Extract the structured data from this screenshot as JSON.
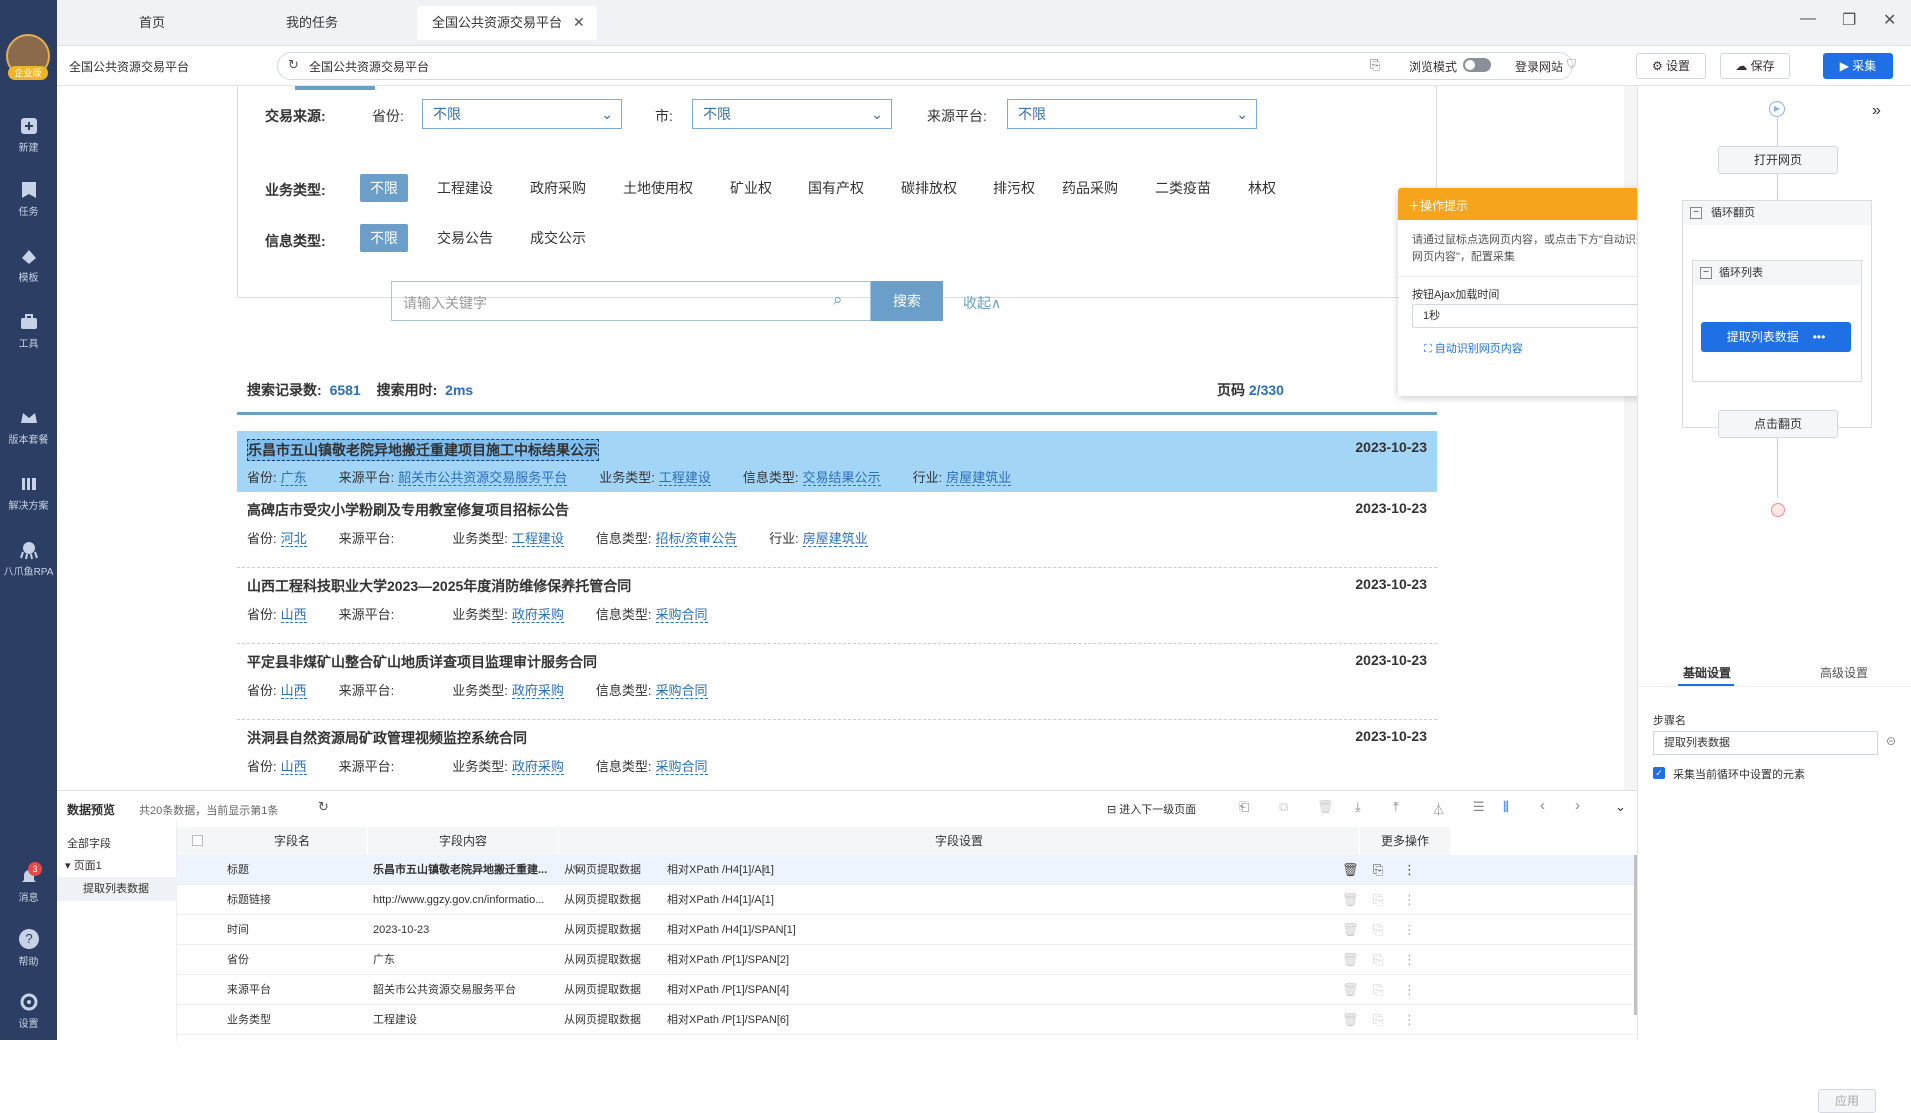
{
  "sidebar": {
    "avatar_label": "企业版",
    "items": [
      {
        "label": "新建",
        "icon": "plus-icon"
      },
      {
        "label": "任务",
        "icon": "bookmark-icon"
      },
      {
        "label": "模板",
        "icon": "template-icon"
      },
      {
        "label": "工具",
        "icon": "toolbox-icon"
      },
      {
        "label": "版本套餐",
        "icon": "crown-icon"
      },
      {
        "label": "解决方案",
        "icon": "solution-icon"
      },
      {
        "label": "八爪鱼RPA",
        "icon": "octopus-icon"
      }
    ],
    "bottom": [
      {
        "label": "消息",
        "badge": "3"
      },
      {
        "label": "帮助"
      },
      {
        "label": "设置"
      }
    ]
  },
  "tabs": [
    {
      "label": "首页"
    },
    {
      "label": "我的任务"
    },
    {
      "label": "全国公共资源交易平台"
    }
  ],
  "address": {
    "page_title": "全国公共资源交易平台",
    "url": "全国公共资源交易平台",
    "browse_mode": "浏览模式",
    "login_site": "登录网站"
  },
  "toolbar": {
    "settings": "设置",
    "save": "保存",
    "collect": "采集"
  },
  "filters": {
    "source_label": "交易来源:",
    "province_label": "省份:",
    "province_value": "不限",
    "city_label": "市:",
    "city_value": "不限",
    "platform_label": "来源平台:",
    "platform_value": "不限",
    "biz_label": "业务类型:",
    "biz_options": [
      "不限",
      "工程建设",
      "政府采购",
      "土地使用权",
      "矿业权",
      "国有产权",
      "碳排放权",
      "排污权",
      "药品采购",
      "二类疫苗",
      "林权"
    ],
    "info_label": "信息类型:",
    "info_options": [
      "不限",
      "交易公告",
      "成交公示"
    ],
    "search_placeholder": "请输入关键字",
    "search_btn": "搜索",
    "collapse": "收起∧"
  },
  "stats": {
    "records_label": "搜索记录数:",
    "records": "6581",
    "time_label": "搜索用时:",
    "time": "2ms",
    "page_label": "页码",
    "page": "2/330"
  },
  "results": [
    {
      "title": "乐昌市五山镇敬老院异地搬迁重建项目施工中标结果公示",
      "date": "2023-10-23",
      "meta": [
        [
          "省份:",
          "广东"
        ],
        [
          "来源平台:",
          "韶关市公共资源交易服务平台"
        ],
        [
          "业务类型:",
          "工程建设"
        ],
        [
          "信息类型:",
          "交易结果公示"
        ],
        [
          "行业:",
          "房屋建筑业"
        ]
      ]
    },
    {
      "title": "高碑店市受灾小学粉刷及专用教室修复项目招标公告",
      "date": "2023-10-23",
      "meta": [
        [
          "省份:",
          "河北"
        ],
        [
          "来源平台:",
          ""
        ],
        [
          "业务类型:",
          "工程建设"
        ],
        [
          "信息类型:",
          "招标/资审公告"
        ],
        [
          "行业:",
          "房屋建筑业"
        ]
      ]
    },
    {
      "title": "山西工程科技职业大学2023—2025年度消防维修保养托管合同",
      "date": "2023-10-23",
      "meta": [
        [
          "省份:",
          "山西"
        ],
        [
          "来源平台:",
          ""
        ],
        [
          "业务类型:",
          "政府采购"
        ],
        [
          "信息类型:",
          "采购合同"
        ]
      ]
    },
    {
      "title": "平定县非煤矿山整合矿山地质详查项目监理审计服务合同",
      "date": "2023-10-23",
      "meta": [
        [
          "省份:",
          "山西"
        ],
        [
          "来源平台:",
          ""
        ],
        [
          "业务类型:",
          "政府采购"
        ],
        [
          "信息类型:",
          "采购合同"
        ]
      ]
    },
    {
      "title": "洪洞县自然资源局矿政管理视频监控系统合同",
      "date": "2023-10-23",
      "meta": [
        [
          "省份:",
          "山西"
        ],
        [
          "来源平台:",
          ""
        ],
        [
          "业务类型:",
          "政府采购"
        ],
        [
          "信息类型:",
          "采购合同"
        ]
      ]
    }
  ],
  "tip": {
    "title": "操作提示",
    "body": "请通过鼠标点选网页内容，或点击下方\"自动识别网页内容\"，配置采集",
    "ajax_label": "按钮Ajax加载时间",
    "ajax_value": "1秒",
    "auto": "自动识别网页内容"
  },
  "flow": {
    "open": "打开网页",
    "loop_page": "循环翻页",
    "loop_list": "循环列表",
    "extract": "提取列表数据",
    "next": "点击翻页",
    "tab_basic": "基础设置",
    "tab_adv": "高级设置",
    "step_label": "步骤名",
    "step_value": "提取列表数据",
    "checkbox": "采集当前循环中设置的元素",
    "apply": "应用"
  },
  "preview": {
    "title": "数据预览",
    "summary": "共20条数据，当前显示第1条",
    "enter_next": "进入下一级页面",
    "all_fields": "全部字段",
    "page1": "页面1",
    "extract": "提取列表数据",
    "cols": [
      "字段名",
      "字段内容",
      "字段设置",
      "更多操作"
    ],
    "rows": [
      {
        "name": "标题",
        "content": "乐昌市五山镇敬老院异地搬迁重建...",
        "src": "从网页提取数据",
        "xp": "相对XPath",
        "path": "/H4[1]/A[1]"
      },
      {
        "name": "标题链接",
        "content": "http://www.ggzy.gov.cn/informatio...",
        "src": "从网页提取数据",
        "xp": "相对XPath",
        "path": "/H4[1]/A[1]"
      },
      {
        "name": "时间",
        "content": "2023-10-23",
        "src": "从网页提取数据",
        "xp": "相对XPath",
        "path": "/H4[1]/SPAN[1]"
      },
      {
        "name": "省份",
        "content": "广东",
        "src": "从网页提取数据",
        "xp": "相对XPath",
        "path": "/P[1]/SPAN[2]"
      },
      {
        "name": "来源平台",
        "content": "韶关市公共资源交易服务平台",
        "src": "从网页提取数据",
        "xp": "相对XPath",
        "path": "/P[1]/SPAN[4]"
      },
      {
        "name": "业务类型",
        "content": "工程建设",
        "src": "从网页提取数据",
        "xp": "相对XPath",
        "path": "/P[1]/SPAN[6]"
      }
    ]
  }
}
